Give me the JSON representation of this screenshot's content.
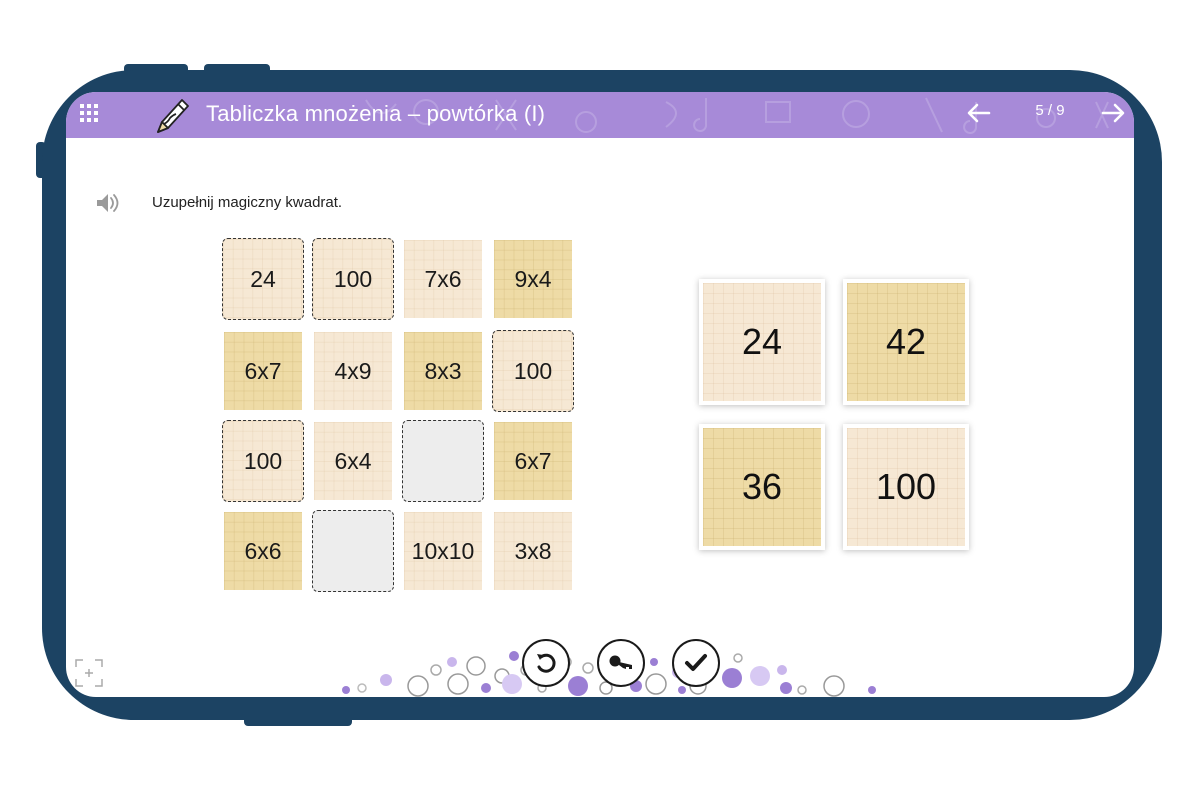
{
  "header": {
    "title": "Tabliczka mnożenia – powtórka (I)",
    "page_counter": "5 / 9",
    "icons": {
      "menu": "grid-menu-icon",
      "lesson": "pen-icon",
      "prev": "arrow-left-icon",
      "next": "arrow-right-icon"
    },
    "color": "#a78ad8"
  },
  "instruction": {
    "text": "Uzupełnij magiczny kwadrat.",
    "icon": "speaker-icon"
  },
  "grid": {
    "rows": [
      [
        {
          "text": "24",
          "style": "light",
          "slot": true
        },
        {
          "text": "100",
          "style": "light",
          "slot": true
        },
        {
          "text": "7x6",
          "style": "light",
          "slot": false
        },
        {
          "text": "9x4",
          "style": "gold",
          "slot": false
        }
      ],
      [
        {
          "text": "6x7",
          "style": "gold",
          "slot": false
        },
        {
          "text": "4x9",
          "style": "light",
          "slot": false
        },
        {
          "text": "8x3",
          "style": "gold",
          "slot": false
        },
        {
          "text": "100",
          "style": "light",
          "slot": true
        }
      ],
      [
        {
          "text": "100",
          "style": "light",
          "slot": true
        },
        {
          "text": "6x4",
          "style": "light",
          "slot": false
        },
        {
          "text": "",
          "style": "empty",
          "slot": true
        },
        {
          "text": "6x7",
          "style": "gold",
          "slot": false
        }
      ],
      [
        {
          "text": "6x6",
          "style": "gold",
          "slot": false
        },
        {
          "text": "",
          "style": "empty",
          "slot": true
        },
        {
          "text": "10x10",
          "style": "light",
          "slot": false
        },
        {
          "text": "3x8",
          "style": "light",
          "slot": false
        }
      ]
    ]
  },
  "answer_cards": [
    {
      "text": "24",
      "style": "light"
    },
    {
      "text": "42",
      "style": "gold"
    },
    {
      "text": "36",
      "style": "gold"
    },
    {
      "text": "100",
      "style": "light"
    }
  ],
  "controls": {
    "reset": "reset-icon",
    "hint": "key-icon",
    "check": "check-icon",
    "fullscreen": "fullscreen-icon"
  },
  "colors": {
    "frame": "#1c4363",
    "accent": "#a78ad8",
    "tile_light": "#f6e8d4",
    "tile_gold": "#eedba6"
  }
}
